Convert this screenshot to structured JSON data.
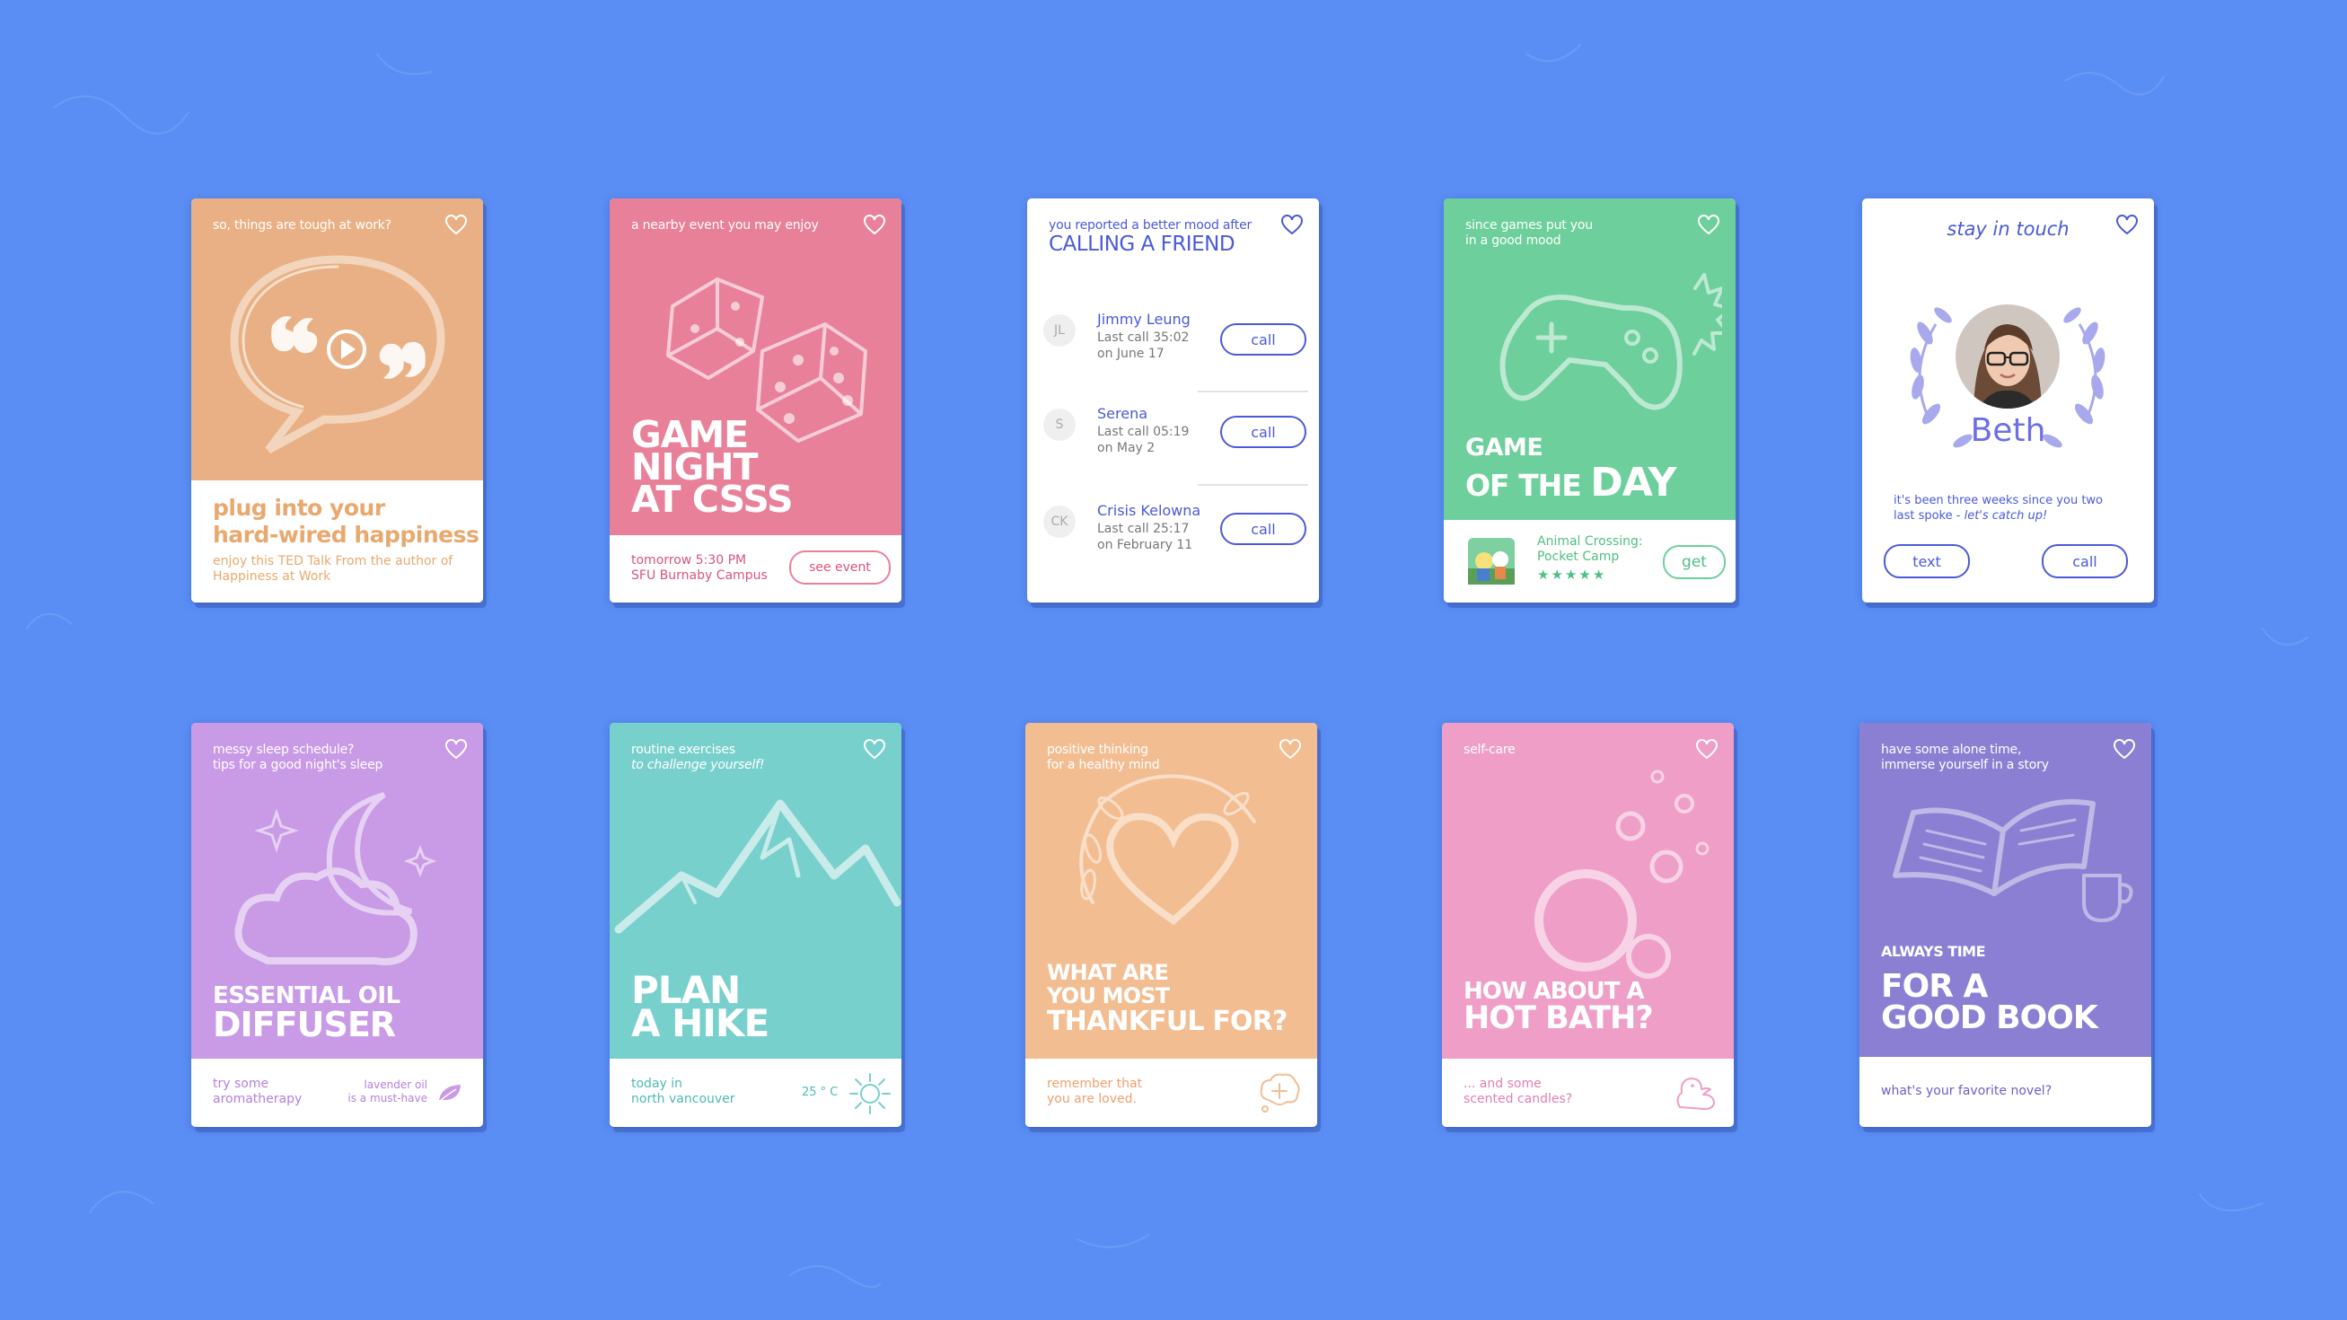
{
  "colors": {
    "background": "#5b8ef5",
    "orange": "#e8b084",
    "pink": "#e98099",
    "green": "#6dcf9b",
    "lilac": "#c99ae6",
    "teal": "#78d0cc",
    "peach": "#f3bd92",
    "rose": "#ef9ec8",
    "purple": "#8a7fd3",
    "blue_text": "#4a5ad8"
  },
  "cards": [
    {
      "eyebrow": "so, things are tough at work?",
      "title_line1": "plug into your",
      "title_line2": "hard-wired happiness",
      "desc_line1": "enjoy this TED Talk From the author of",
      "desc_line2": "Happiness at Work",
      "icons": [
        "heart-icon",
        "speech-bubble-play-icon"
      ]
    },
    {
      "eyebrow": "a nearby event you may enjoy",
      "title_line1": "GAME",
      "title_line2": "NIGHT",
      "title_line3": "AT CSSS",
      "time": "tomorrow 5:30 PM",
      "place": "SFU Burnaby Campus",
      "button": "see event",
      "icons": [
        "heart-icon",
        "dice-icon"
      ]
    },
    {
      "eyebrow": "you reported a better mood after",
      "title": "CALLING A FRIEND",
      "contacts": [
        {
          "initials": "JL",
          "name": "Jimmy Leung",
          "last_call": "Last call 35:02",
          "date": "on June 17",
          "button": "call"
        },
        {
          "initials": "S",
          "name": "Serena",
          "last_call": "Last call 05:19",
          "date": "on May 2",
          "button": "call"
        },
        {
          "initials": "CK",
          "name": "Crisis Kelowna",
          "last_call": "Last call 25:17",
          "date": "on February 11",
          "button": "call"
        }
      ]
    },
    {
      "eyebrow_line1": "since games put you",
      "eyebrow_line2": "in a good mood",
      "title_line1": "GAME",
      "title_line2a": "OF THE",
      "title_line2b": "DAY",
      "app_name_line1": "Animal Crossing:",
      "app_name_line2": "Pocket Camp",
      "rating": 5,
      "button": "get",
      "icons": [
        "heart-icon",
        "game-controller-icon",
        "app-thumbnail-icon",
        "star-icon"
      ]
    },
    {
      "eyebrow": "stay in touch",
      "name": "Beth",
      "message_line1": "it's been three weeks since you two",
      "message_line2a": "last spoke -",
      "message_line2b": "let's catch up!",
      "button_text": "text",
      "button_call": "call",
      "icons": [
        "heart-icon",
        "laurel-wreath-icon",
        "avatar"
      ]
    },
    {
      "eyebrow_line1": "messy sleep schedule?",
      "eyebrow_line2": "tips for a good night's sleep",
      "title_line1": "ESSENTIAL OIL",
      "title_line2": "DIFFUSER",
      "footer_left_line1": "try some",
      "footer_left_line2": "aromatherapy",
      "footer_right_line1": "lavender oil",
      "footer_right_line2": "is a must-have",
      "icons": [
        "heart-icon",
        "moon-cloud-icon",
        "leaf-icon"
      ]
    },
    {
      "eyebrow_line1": "routine exercises",
      "eyebrow_line2": "to challenge yourself!",
      "title_line1": "PLAN",
      "title_line2": "A HIKE",
      "footer_line1": "today in",
      "footer_line2": "north vancouver",
      "temperature": "25 ° C",
      "icons": [
        "heart-icon",
        "mountain-icon",
        "sun-icon"
      ]
    },
    {
      "eyebrow_line1": "positive thinking",
      "eyebrow_line2": "for a healthy mind",
      "title_line1": "WHAT ARE",
      "title_line2": "YOU MOST",
      "title_line3": "THANKFUL FOR?",
      "footer_line1": "remember that",
      "footer_line2": "you are loved.",
      "icons": [
        "heart-icon",
        "heart-wreath-icon",
        "thought-bubble-icon"
      ]
    },
    {
      "eyebrow": "self-care",
      "title_line1": "HOW ABOUT A",
      "title_line2": "HOT BATH?",
      "footer_line1": "... and some",
      "footer_line2": "scented candles?",
      "icons": [
        "heart-icon",
        "bubbles-icon",
        "rubber-duck-icon"
      ]
    },
    {
      "eyebrow_line1": "have some alone time,",
      "eyebrow_line2": "immerse yourself in a story",
      "kicker": "ALWAYS TIME",
      "title_line1": "FOR A",
      "title_line2": "GOOD BOOK",
      "footer": "what's your favorite novel?",
      "icons": [
        "heart-icon",
        "open-book-icon"
      ]
    }
  ]
}
